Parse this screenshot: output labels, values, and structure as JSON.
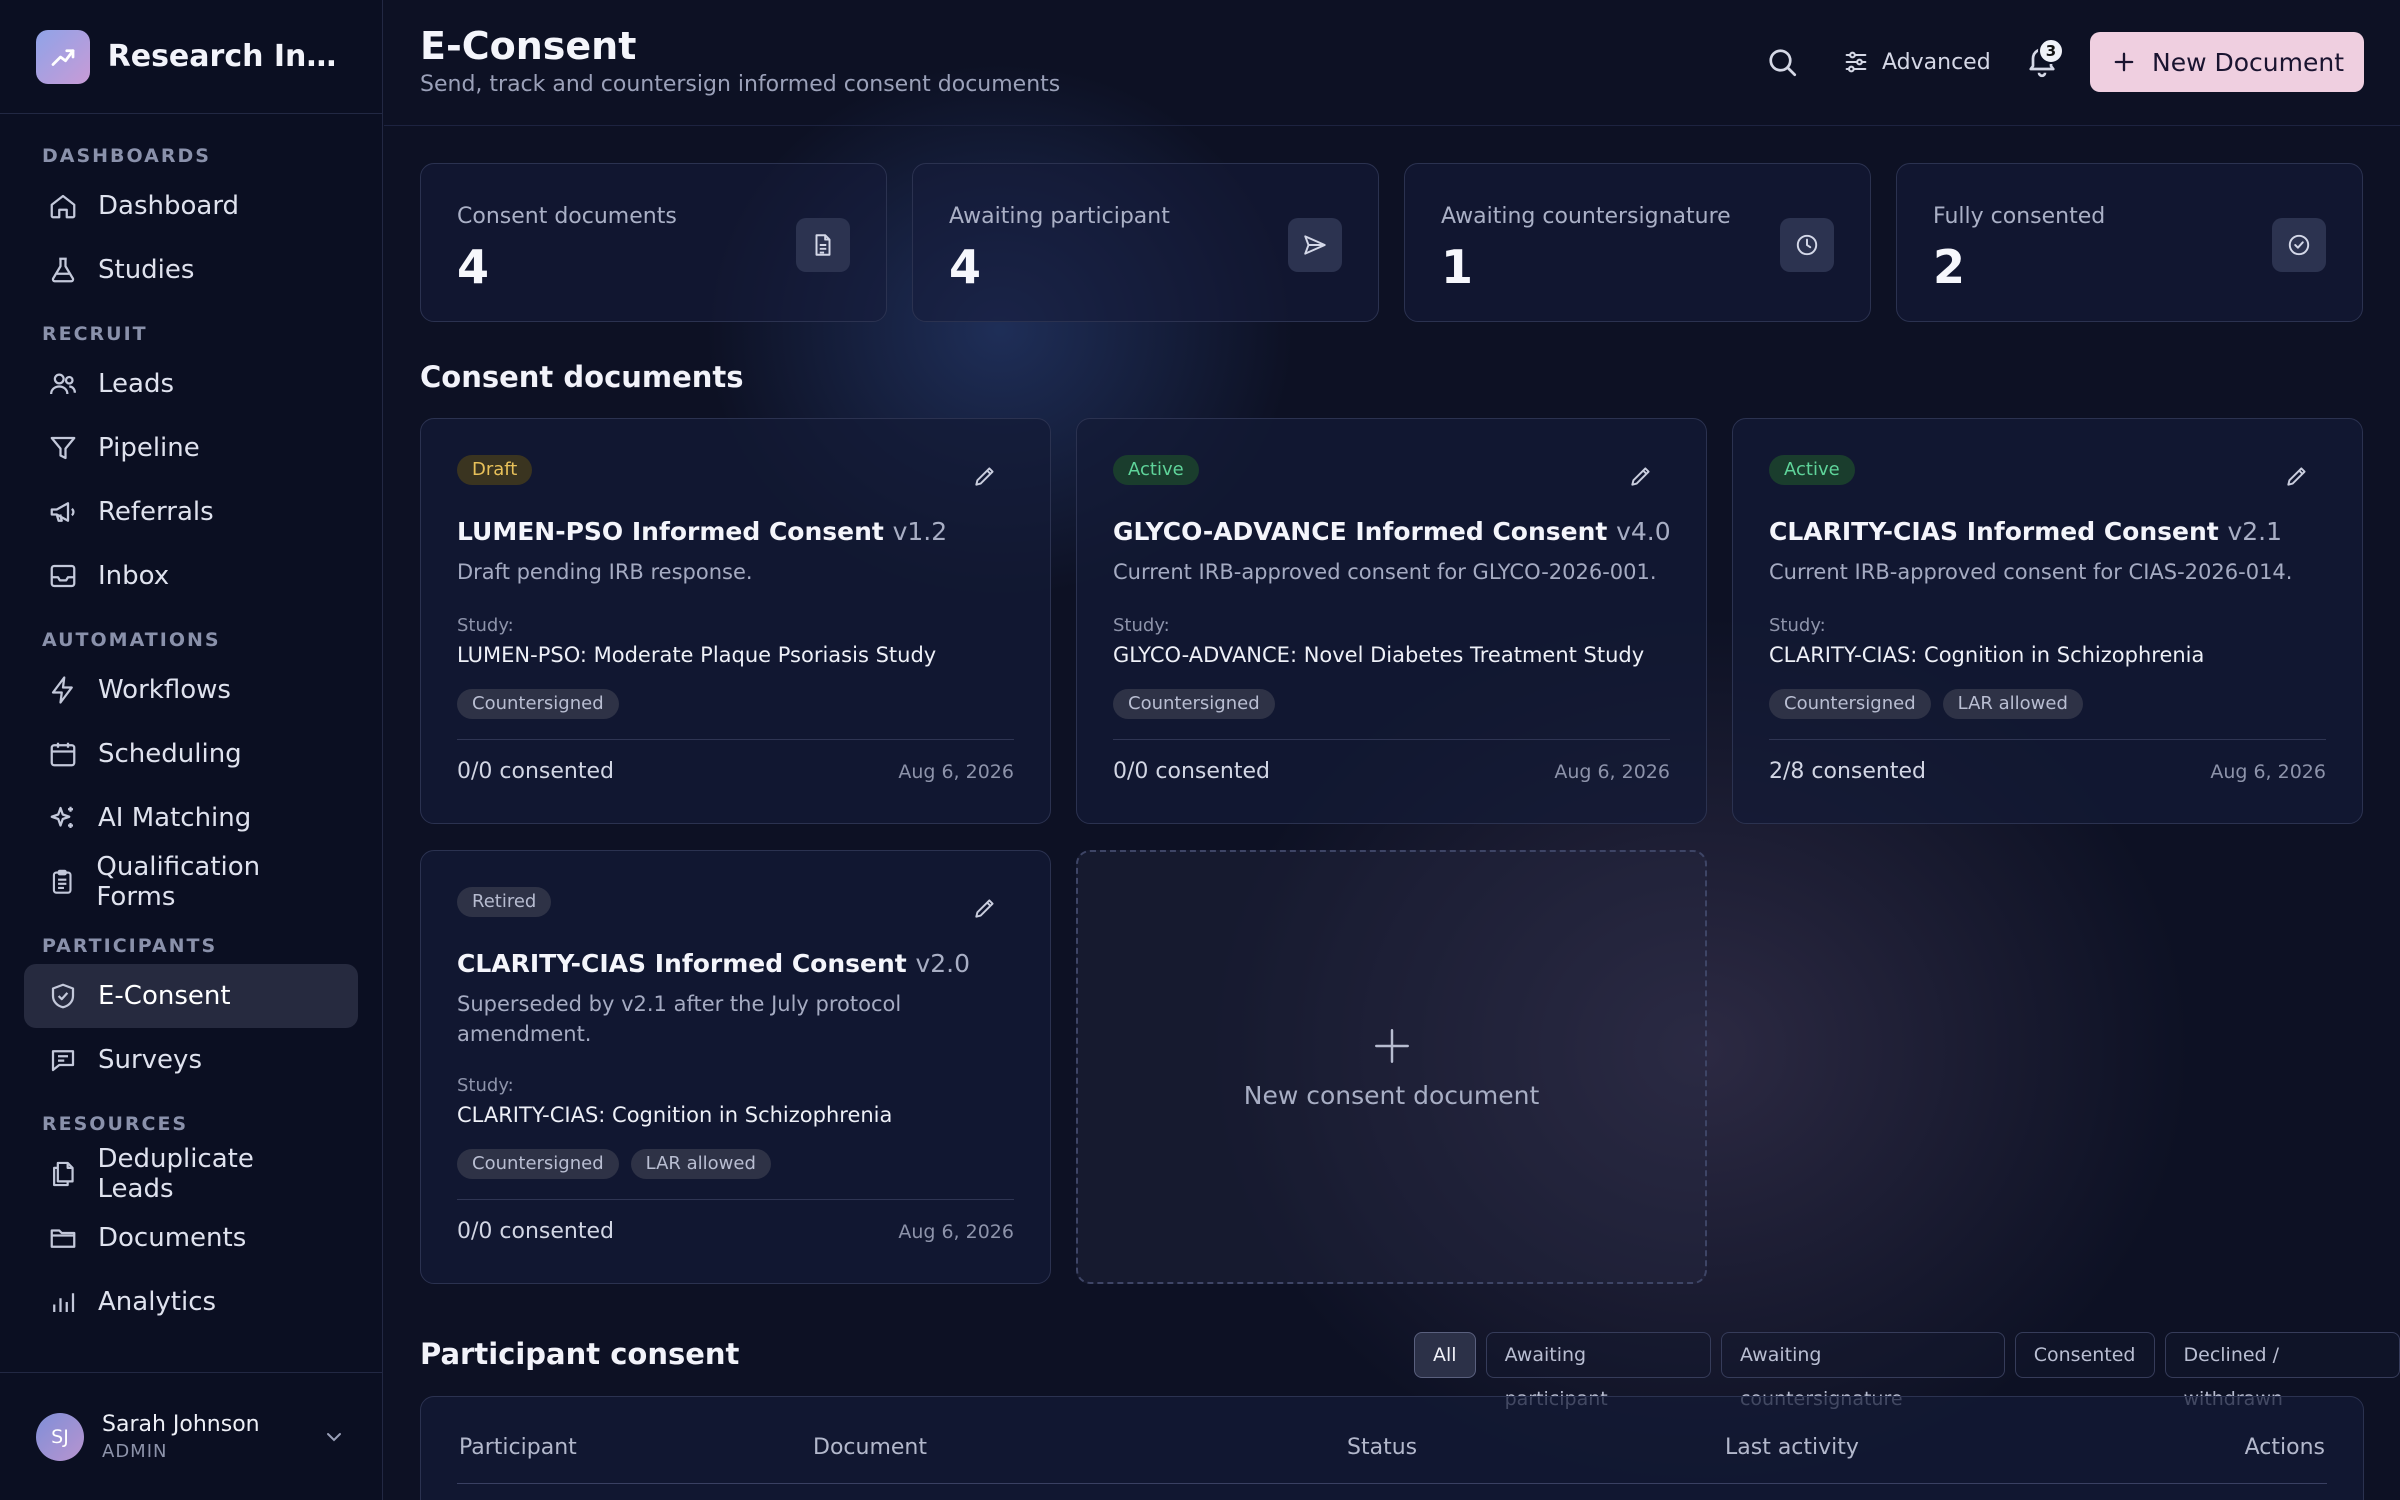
{
  "brand": {
    "name": "Research Inst..."
  },
  "sidebar": {
    "sections": [
      {
        "title": "DASHBOARDS",
        "items": [
          {
            "label": "Dashboard",
            "icon": "home-icon"
          },
          {
            "label": "Studies",
            "icon": "flask-icon"
          }
        ]
      },
      {
        "title": "RECRUIT",
        "items": [
          {
            "label": "Leads",
            "icon": "users-icon"
          },
          {
            "label": "Pipeline",
            "icon": "filter-icon"
          },
          {
            "label": "Referrals",
            "icon": "megaphone-icon"
          },
          {
            "label": "Inbox",
            "icon": "inbox-icon"
          }
        ]
      },
      {
        "title": "AUTOMATIONS",
        "items": [
          {
            "label": "Workflows",
            "icon": "lightning-icon"
          },
          {
            "label": "Scheduling",
            "icon": "calendar-icon"
          },
          {
            "label": "AI Matching",
            "icon": "sparkles-icon"
          },
          {
            "label": "Qualification Forms",
            "icon": "clipboard-icon"
          }
        ]
      },
      {
        "title": "PARTICIPANTS",
        "items": [
          {
            "label": "E-Consent",
            "icon": "shield-check-icon",
            "active": true
          },
          {
            "label": "Surveys",
            "icon": "message-icon"
          }
        ]
      },
      {
        "title": "RESOURCES",
        "items": [
          {
            "label": "Deduplicate Leads",
            "icon": "copy-icon"
          },
          {
            "label": "Documents",
            "icon": "folder-icon"
          },
          {
            "label": "Analytics",
            "icon": "bar-chart-icon"
          }
        ]
      }
    ]
  },
  "user": {
    "initials": "SJ",
    "name": "Sarah Johnson",
    "role": "ADMIN"
  },
  "header": {
    "title": "E-Consent",
    "subtitle": "Send, track and countersign informed consent documents",
    "advanced_label": "Advanced",
    "notification_count": "3",
    "new_document_label": "New Document"
  },
  "stats": [
    {
      "label": "Consent documents",
      "value": "4",
      "icon": "document-icon"
    },
    {
      "label": "Awaiting participant",
      "value": "4",
      "icon": "send-icon"
    },
    {
      "label": "Awaiting countersignature",
      "value": "1",
      "icon": "clock-icon"
    },
    {
      "label": "Fully consented",
      "value": "2",
      "icon": "check-circle-icon"
    }
  ],
  "documents_heading": "Consent documents",
  "documents": [
    {
      "status": "Draft",
      "title": "LUMEN-PSO Informed Consent",
      "version": "v1.2",
      "description": "Draft pending IRB response.",
      "study_label": "Study:",
      "study": "LUMEN-PSO: Moderate Plaque Psoriasis Study",
      "tags": [
        "Countersigned"
      ],
      "consented": "0/0 consented",
      "date": "Aug 6, 2026"
    },
    {
      "status": "Active",
      "title": "GLYCO-ADVANCE Informed Consent",
      "version": "v4.0",
      "description": "Current IRB-approved consent for GLYCO-2026-001.",
      "study_label": "Study:",
      "study": "GLYCO-ADVANCE: Novel Diabetes Treatment Study",
      "tags": [
        "Countersigned"
      ],
      "consented": "0/0 consented",
      "date": "Aug 6, 2026"
    },
    {
      "status": "Active",
      "title": "CLARITY-CIAS Informed Consent",
      "version": "v2.1",
      "description": "Current IRB-approved consent for CIAS-2026-014.",
      "study_label": "Study:",
      "study": "CLARITY-CIAS: Cognition in Schizophrenia",
      "tags": [
        "Countersigned",
        "LAR allowed"
      ],
      "consented": "2/8 consented",
      "date": "Aug 6, 2026"
    },
    {
      "status": "Retired",
      "title": "CLARITY-CIAS Informed Consent",
      "version": "v2.0",
      "description": "Superseded by v2.1 after the July protocol amendment.",
      "study_label": "Study:",
      "study": "CLARITY-CIAS: Cognition in Schizophrenia",
      "tags": [
        "Countersigned",
        "LAR allowed"
      ],
      "consented": "0/0 consented",
      "date": "Aug 6, 2026"
    }
  ],
  "new_document_card": {
    "label": "New consent document"
  },
  "participant": {
    "heading": "Participant consent",
    "filters": [
      "All",
      "Awaiting participant",
      "Awaiting countersignature",
      "Consented",
      "Declined / withdrawn"
    ],
    "columns": [
      "Participant",
      "Document",
      "Status",
      "Last activity",
      "Actions"
    ]
  }
}
